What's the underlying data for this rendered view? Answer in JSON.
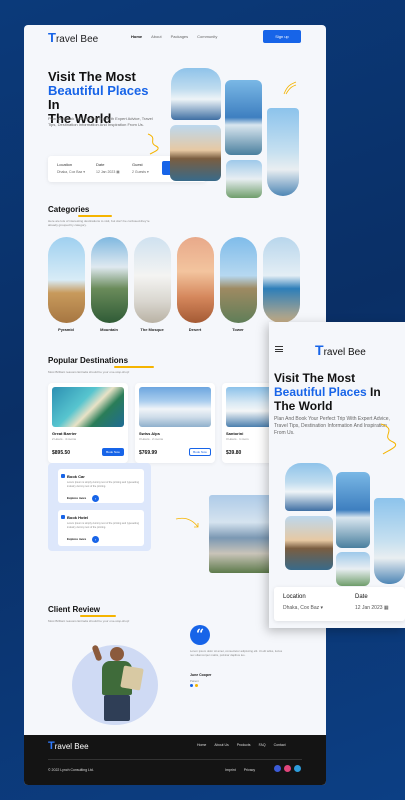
{
  "brand": {
    "logo_letter": "T",
    "logo_rest": "ravel Bee",
    "accent": "#1764e8",
    "highlight": "#f5b400"
  },
  "nav": {
    "links": [
      "Home",
      "About",
      "Packages",
      "Community"
    ],
    "signup": "Sign up"
  },
  "hero": {
    "title_line1": "Visit The Most",
    "title_blue": "Beautiful Places",
    "title_line2_rest": " In",
    "title_line3": "The World",
    "subtitle": "Plan And Book Your Perfect Trip With Expert Advice, Travel Tips, Destination Information And Inspiration From Us."
  },
  "search": {
    "location_label": "Location",
    "location_value": "Dhaka, Cox Baz",
    "date_label": "Date",
    "date_value": "12 Jan 2023",
    "guest_label": "Guest",
    "guest_value": "2 Guests",
    "button": "Search"
  },
  "categories": {
    "title": "Categories",
    "subtitle": "Here are lots of interesting destinations to visit, but don't be confused-they're already grouped by category.",
    "items": [
      "Pyramid",
      "Mountain",
      "The Mosque",
      "Desert",
      "Tower",
      "Beach"
    ]
  },
  "popular": {
    "title": "Popular Destinations",
    "subtitle": "Most Brilliant reasons Entrada should be your one-stop-shop!",
    "cards": [
      {
        "name": "Great Barrier",
        "meta": "2 Hours · 4 rooms",
        "price": "$895.50",
        "button": "Book Now"
      },
      {
        "name": "Swiss Alps",
        "meta": "3 Hours · 2 rooms",
        "price": "$769.99",
        "button": "Book Now"
      },
      {
        "name": "Santorini",
        "meta": "3 Hours · 1 room",
        "price": "$39.80",
        "button": ""
      }
    ]
  },
  "booking": {
    "items": [
      {
        "title": "Book Car",
        "desc": "Lorem Ipsum is simply dummy text of the printing and typesetting industry dummy text of the printing.",
        "explore": "Explore more"
      },
      {
        "title": "Book Hotel",
        "desc": "Lorem Ipsum is simply dummy text of the printing and typesetting industry dummy text of the printing.",
        "explore": "Explore more"
      }
    ]
  },
  "review": {
    "title": "Client Review",
    "subtitle": "Most Brilliant reasons Entrada should be your one-stop-shop!",
    "quote_mark": "“",
    "text": "Lorem ipsum dolor sit amet, consectetur adipiscing elit. Ut elit tellus, luctus nec ullamcorper mattis, pulvinar dapibus leo.",
    "name": "June Cooper",
    "role": "Patient"
  },
  "footer": {
    "links": [
      "Home",
      "About Us",
      "Products",
      "FAQ",
      "Contact"
    ],
    "copyright": "© 2022 Lynch Consulting Ltd.",
    "legal": [
      "Imprint",
      "Privacy"
    ]
  },
  "mobile": {
    "title_line1": "Visit The Most",
    "title_blue": "Beautiful Places",
    "title_rest": " In",
    "title_line3": "The World",
    "subtitle": "Plan And Book Your Perfect Trip With Expert Advice, Travel Tips, Destination Information And Inspiration From Us.",
    "location_label": "Location",
    "location_value": "Dhaka, Cox Baz",
    "date_label": "Date",
    "date_value": "12 Jan 2023"
  }
}
